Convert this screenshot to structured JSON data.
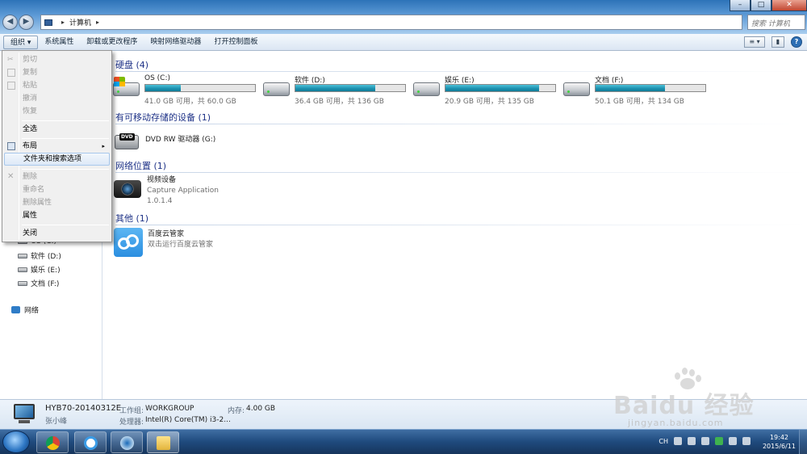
{
  "window": {
    "address_segments": [
      "计算机"
    ],
    "search_placeholder": "搜索 计算机",
    "minimize": "–",
    "maximize": "□",
    "close": "✕"
  },
  "toolbar": {
    "organize": "组织 ▾",
    "items": [
      "系统属性",
      "卸载或更改程序",
      "映射网络驱动器",
      "打开控制面板"
    ],
    "view_icon": "≡ ▾",
    "pane_icon": "▮",
    "help_icon": "?"
  },
  "menu": {
    "items": [
      {
        "label": "剪切",
        "enabled": false
      },
      {
        "label": "复制",
        "enabled": false
      },
      {
        "label": "粘贴",
        "enabled": false
      },
      {
        "label": "撤消",
        "enabled": false
      },
      {
        "label": "恢复",
        "enabled": false
      },
      {
        "label": "全选",
        "enabled": true
      },
      {
        "label": "布局",
        "enabled": true,
        "submenu": "▸"
      },
      {
        "label": "文件夹和搜索选项",
        "enabled": true,
        "highlighted": true
      },
      {
        "label": "删除",
        "enabled": false
      },
      {
        "label": "重命名",
        "enabled": false
      },
      {
        "label": "删除属性",
        "enabled": false
      },
      {
        "label": "属性",
        "enabled": true
      },
      {
        "label": "关闭",
        "enabled": true
      }
    ]
  },
  "nav": {
    "partial_item": "OS (C:)",
    "drives": [
      "软件 (D:)",
      "娱乐 (E:)",
      "文档 (F:)"
    ],
    "network": "网络"
  },
  "groups": {
    "hard_disks": "硬盘 (4)",
    "removable": "有可移动存储的设备 (1)",
    "network": "网络位置 (1)",
    "other": "其他 (1)"
  },
  "drives": [
    {
      "name": "OS (C:)",
      "free": "41.0 GB 可用，共 60.0 GB",
      "used_fraction": 0.32,
      "system": true
    },
    {
      "name": "软件 (D:)",
      "free": "36.4 GB 可用，共 136 GB",
      "used_fraction": 0.73,
      "system": false
    },
    {
      "name": "娱乐 (E:)",
      "free": "20.9 GB 可用，共 135 GB",
      "used_fraction": 0.85,
      "system": false
    },
    {
      "name": "文档 (F:)",
      "free": "50.1 GB 可用，共 134 GB",
      "used_fraction": 0.63,
      "system": false
    }
  ],
  "removable": {
    "name": "DVD RW 驱动器 (G:)",
    "badge": "DVD"
  },
  "network_loc": {
    "name": "视频设备",
    "line2": "Capture Application",
    "line3": "1.0.1.4"
  },
  "other": {
    "name": "百度云管家",
    "sub": "双击运行百度云管家"
  },
  "details": {
    "computer_name": "HYB70-20140312E",
    "user": "张小峰",
    "workgroup_label": "工作组:",
    "workgroup": "WORKGROUP",
    "memory_label": "内存:",
    "memory": "4.00 GB",
    "cpu_label": "处理器:",
    "cpu": "Intel(R) Core(TM) i3-2..."
  },
  "taskbar": {
    "lang": "CH",
    "time": "19:42",
    "date": "2015/6/11"
  },
  "watermark": {
    "brand": "Baidu 经验",
    "url": "jingyan.baidu.com"
  }
}
